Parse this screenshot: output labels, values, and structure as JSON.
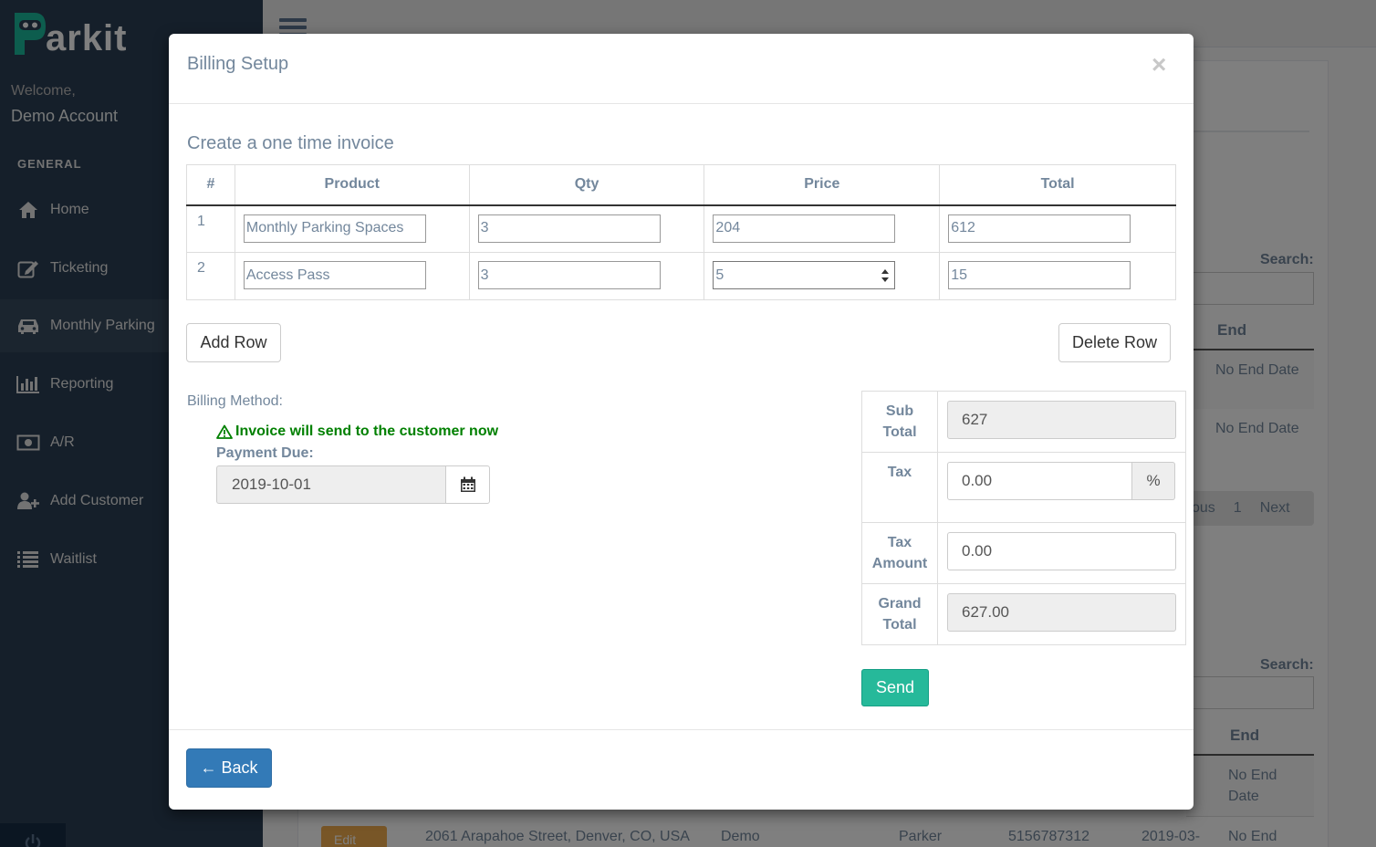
{
  "brand": {
    "logo_text": "arkit",
    "logo_letter": "P"
  },
  "sidebar": {
    "welcome": "Welcome,",
    "username": "Demo Account",
    "section": "GENERAL",
    "items": [
      {
        "label": "Home",
        "icon": "home-icon"
      },
      {
        "label": "Ticketing",
        "icon": "edit-icon"
      },
      {
        "label": "Monthly Parking",
        "icon": "car-icon",
        "active": true
      },
      {
        "label": "Reporting",
        "icon": "bar-chart-icon"
      },
      {
        "label": "A/R",
        "icon": "money-icon"
      },
      {
        "label": "Add Customer",
        "icon": "user-plus-icon"
      },
      {
        "label": "Waitlist",
        "icon": "list-icon"
      }
    ]
  },
  "background": {
    "search_label_1": "Search:",
    "search_label_2": "Search:",
    "col_end_1": "End",
    "col_end_2": "End",
    "no_end_date_1": "No End Date",
    "no_end_date_2": "No End Date",
    "no_end_date_3a": "No End",
    "no_end_date_3b": "Date",
    "no_end_date_4": "No End",
    "pager_prev": "ous",
    "pager_page": "1",
    "pager_next": "Next",
    "edit_label": "Edit",
    "row_address": "2061 Arapahoe Street, Denver, CO, USA",
    "row_first": "Demo",
    "row_last": "Parker",
    "row_phone": "5156787312",
    "row_start": "2019-03-"
  },
  "modal": {
    "title": "Billing Setup",
    "close": "×",
    "subtitle": "Create a one time invoice",
    "columns": [
      "#",
      "Product",
      "Qty",
      "Price",
      "Total"
    ],
    "rows": [
      {
        "num": "1",
        "product": "Monthly Parking Spaces",
        "qty": "3",
        "price": "204",
        "total": "612"
      },
      {
        "num": "2",
        "product": "Access Pass",
        "qty": "3",
        "price": "5",
        "total": "15"
      }
    ],
    "add_row": "Add Row",
    "delete_row": "Delete Row",
    "billing_method_label": "Billing Method:",
    "invoice_notice": "Invoice will send to the customer now",
    "payment_due_label": "Payment Due:",
    "payment_due_value": "2019-10-01",
    "totals": {
      "sub_total_label_1": "Sub",
      "sub_total_label_2": "Total",
      "sub_total": "627",
      "tax_label": "Tax",
      "tax": "0.00",
      "tax_unit": "%",
      "tax_amount_label_1": "Tax",
      "tax_amount_label_2": "Amount",
      "tax_amount": "0.00",
      "grand_total_label_1": "Grand",
      "grand_total_label_2": "Total",
      "grand_total": "627.00"
    },
    "send": "Send",
    "back": "← Back"
  },
  "colors": {
    "sidebar_bg": "#2a3f54",
    "brand_green": "#1abb9c",
    "send_green": "#26b99a",
    "back_blue": "#337ab7",
    "notice_green": "#008000"
  }
}
